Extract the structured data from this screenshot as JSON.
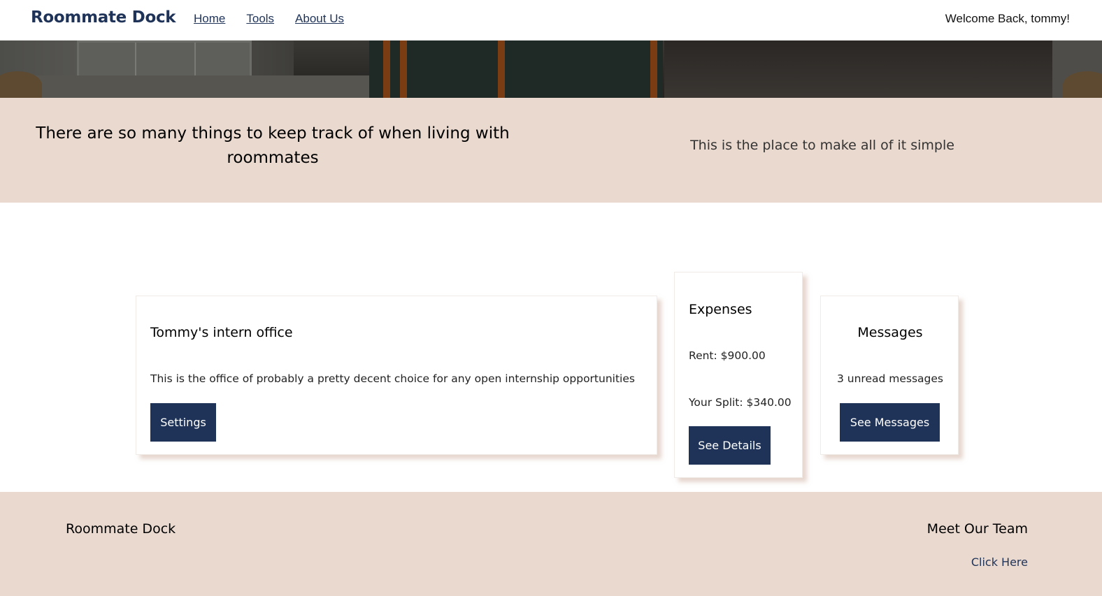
{
  "nav": {
    "brand": "Roommate Dock",
    "links": [
      {
        "label": "Home"
      },
      {
        "label": "Tools"
      },
      {
        "label": "About Us"
      }
    ],
    "welcome": "Welcome Back, tommy!"
  },
  "tagline": {
    "left": "There are so many things to keep track of when living with roommates",
    "right": "This is the place to make all of it simple"
  },
  "cards": {
    "office": {
      "title": "Tommy's intern office",
      "text": "This is the office of probably a pretty decent choice for any open internship opportunities",
      "button": "Settings"
    },
    "expenses": {
      "title": "Expenses",
      "rent": "Rent: $900.00",
      "split": "Your Split: $340.00",
      "button": "See Details"
    },
    "messages": {
      "title": "Messages",
      "text": "3 unread messages",
      "button": "See Messages"
    }
  },
  "footer": {
    "brand": "Roommate Dock",
    "team_heading": "Meet Our Team",
    "team_link": "Click Here"
  },
  "colors": {
    "brand_navy": "#1f3358",
    "accent_band": "#ead9cf"
  }
}
